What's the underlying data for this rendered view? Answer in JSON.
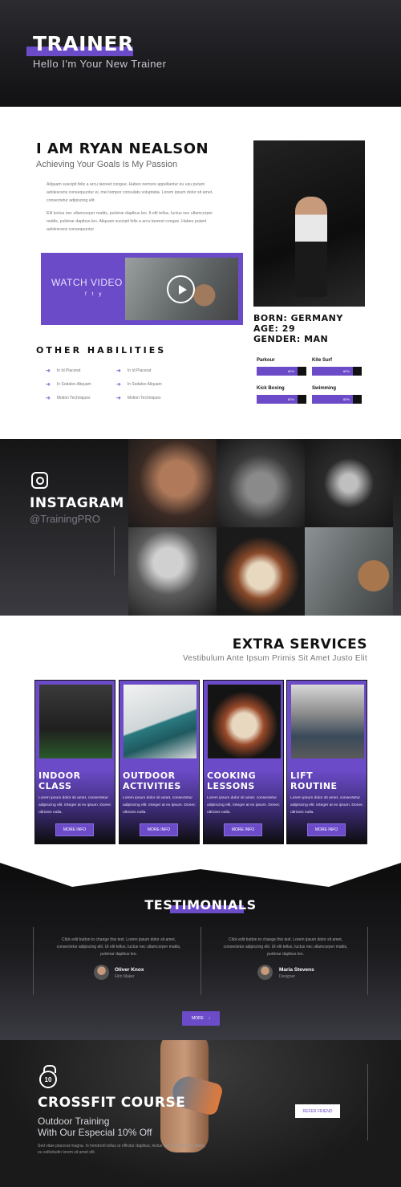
{
  "hero": {
    "title": "TRAINER",
    "subtitle": "Hello I'm Your New Trainer"
  },
  "about": {
    "name": "I AM RYAN NEALSON",
    "tagline": "Achieving Your Goals Is My Passion",
    "p1": "Aliquam suscipit felis a arcu laoreet congue. Habeo nemore appellantur eu usu putant adolescens consequuntur ei, mei tempor consulatu voluptatia. Lorem ipsum dolor sit amet, consectetur adipiscing elit.",
    "p2": "Elit luctus nec ullamcorper mattis, pulvinar dapibus leo. It elit tellus, luctus nec ullamcorper mattis, pulvinar dapibus leo. Aliquam suscipit felis a arcu laoreet congue. Habeo putant adolescens consequuntur",
    "watch": "WATCH VIDEO",
    "social": [
      "f",
      "t",
      "y"
    ],
    "born": "BORN: GERMANY",
    "age": "AGE: 29",
    "gender": "GENDER: MAN"
  },
  "habilities": {
    "title": "OTHER HABILITIES",
    "items": [
      "In Id Placerat",
      "In Id Placerat",
      "In Sodales Aliquam",
      "In Sodales Aliquam",
      "Motion Techniques",
      "Motion Techniques"
    ]
  },
  "skills": [
    {
      "name": "Parkour",
      "pct": "82%",
      "value": 82
    },
    {
      "name": "Kite Surf",
      "pct": "82%",
      "value": 82
    },
    {
      "name": "Kick Boxing",
      "pct": "82%",
      "value": 82
    },
    {
      "name": "Swimming",
      "pct": "82%",
      "value": 82
    }
  ],
  "instagram": {
    "title": "INSTAGRAM",
    "handle": "@TrainingPRO"
  },
  "services": {
    "title": "EXTRA SERVICES",
    "subtitle": "Vestibulum Ante Ipsum Primis Sit Amet Justo Elit",
    "cards": [
      {
        "t1": "INDOOR",
        "t2": "CLASS",
        "text": "Lorem ipsum dolor sit amet, consectetur adipiscing elit. Integer at ex ipsum. Donec ultricies nulla.",
        "btn": "MORE INFO"
      },
      {
        "t1": "OUTDOOR",
        "t2": "ACTIVITIES",
        "text": "Lorem ipsum dolor sit amet, consectetur adipiscing elit. Integer at ex ipsum. Donec ultricies nulla.",
        "btn": "MORE INFO"
      },
      {
        "t1": "COOKING",
        "t2": "LESSONS",
        "text": "Lorem ipsum dolor sit amet, consectetur adipiscing elit. Integer at ex ipsum. Donec ultricies nulla.",
        "btn": "MORE INFO"
      },
      {
        "t1": "LIFT",
        "t2": "ROUTINE",
        "text": "Lorem ipsum dolor sit amet, consectetur adipiscing elit. Integer at ex ipsum. Donec ultricies nulla.",
        "btn": "MORE INFO"
      }
    ]
  },
  "testimonials": {
    "title": "TESTIMONIALS",
    "more": "MORE",
    "items": [
      {
        "text": "Click edit button to change this text. Lorem ipsum dolor sit amet, consectetur adipiscing elit. Ut elit tellus, luctus nec ullamcorper mattis, pulvinar dapibus leo.",
        "name": "Oliver Knox",
        "role": "Film Maker"
      },
      {
        "text": "Click edit button to change this text. Lorem ipsum dolor sit amet, consectetur adipiscing elit. Ut elit tellus, luctus nec ullamcorper mattis, pulvinar dapibus leo.",
        "name": "Maria Stevens",
        "role": "Designer"
      }
    ]
  },
  "crossfit": {
    "kb": "10",
    "title": "CROSSFIT COURSE",
    "sub1": "Outdoor Training",
    "sub2": "With Our Especial 10% Off",
    "text": "Sed vitae placerat magna. In hendrerit tellus ut efficitur dapibus, lectus turpis fermentum libero, eu sollicitudin lorem sit amet elit.",
    "btn": "REFER FRIEND"
  },
  "colors": {
    "accent": "#6c4bc9"
  }
}
